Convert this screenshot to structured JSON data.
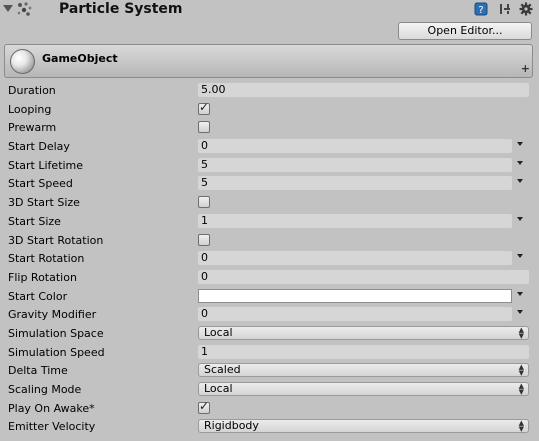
{
  "component": {
    "title": "Particle System",
    "open_editor_label": "Open Editor...",
    "icons": [
      "help-icon",
      "preset-icon",
      "gear-icon"
    ]
  },
  "module": {
    "title": "GameObject",
    "plus": "+"
  },
  "fields": [
    {
      "label": "Duration",
      "type": "float",
      "value": "5.00"
    },
    {
      "label": "Looping",
      "type": "checkbox",
      "checked": true,
      "mark": "✓"
    },
    {
      "label": "Prewarm",
      "type": "checkbox",
      "checked": false
    },
    {
      "label": "Start Delay",
      "type": "curve",
      "value": "0"
    },
    {
      "label": "Start Lifetime",
      "type": "curve",
      "value": "5"
    },
    {
      "label": "Start Speed",
      "type": "curve",
      "value": "5"
    },
    {
      "label": "3D Start Size",
      "type": "checkbox",
      "checked": false
    },
    {
      "label": "Start Size",
      "type": "curve",
      "value": "1"
    },
    {
      "label": "3D Start Rotation",
      "type": "checkbox",
      "checked": false
    },
    {
      "label": "Start Rotation",
      "type": "curve",
      "value": "0"
    },
    {
      "label": "Flip Rotation",
      "type": "float",
      "value": "0"
    },
    {
      "label": "Start Color",
      "type": "color",
      "value": "#ffffff"
    },
    {
      "label": "Gravity Modifier",
      "type": "curve",
      "value": "0"
    },
    {
      "label": "Simulation Space",
      "type": "popup",
      "value": "Local"
    },
    {
      "label": "Simulation Speed",
      "type": "float",
      "value": "1"
    },
    {
      "label": "Delta Time",
      "type": "popup",
      "value": "Scaled"
    },
    {
      "label": "Scaling Mode",
      "type": "popup",
      "value": "Local"
    },
    {
      "label": "Play On Awake*",
      "type": "checkbox",
      "checked": true,
      "mark": "✓"
    },
    {
      "label": "Emitter Velocity",
      "type": "popup",
      "value": "Rigidbody"
    }
  ],
  "colors": {
    "background": "#c2c2c2",
    "field": "#d6d6d6",
    "start_color": "#ffffff"
  }
}
